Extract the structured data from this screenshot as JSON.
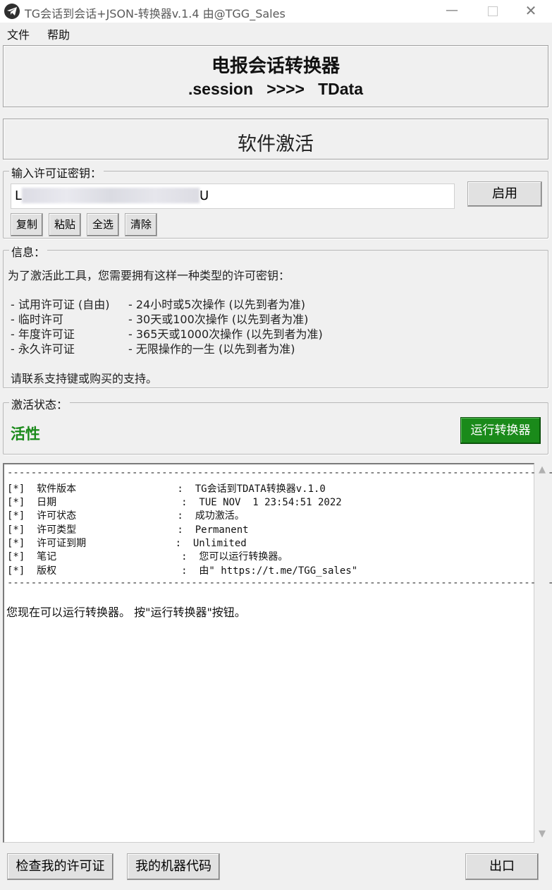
{
  "window": {
    "title": "TG会话到会话+JSON-转换器v.1.4 由@TGG_Sales",
    "controls": {
      "minimize": "—",
      "close": "✕"
    }
  },
  "menu": {
    "file": "文件",
    "help": "帮助"
  },
  "header": {
    "heading": "电报会话转换器",
    "subheading": ".session   >>>>   TData"
  },
  "activation": {
    "title": "软件激活"
  },
  "license": {
    "legend": "输入许可证密钥：",
    "key_start": "L",
    "key_end": "U",
    "enable_label": "启用",
    "copy_label": "复制",
    "paste_label": "粘贴",
    "select_all_label": "全选",
    "clear_label": "清除"
  },
  "info": {
    "legend": "信息：",
    "intro": "为了激活此工具，您需要拥有这样一种类型的许可密钥：",
    "license_types": [
      {
        "name": "- 试用许可证 (自由)",
        "desc": "- 24小时或5次操作 (以先到者为准)"
      },
      {
        "name": "- 临时许可",
        "desc": "- 30天或100次操作 (以先到者为准)"
      },
      {
        "name": "- 年度许可证",
        "desc": "- 365天或1000次操作 (以先到者为准)"
      },
      {
        "name": "- 永久许可证",
        "desc": "- 无限操作的一生 (以先到者为准)"
      }
    ],
    "contact": "请联系支持键或购买的支持。"
  },
  "status": {
    "legend": "激活状态：",
    "value": "活性",
    "run_label": "运行转换器",
    "colors": {
      "active_text": "#1b8a1b",
      "run_button": "#1a8a1a"
    }
  },
  "log": {
    "separator": "----------------------------------------------------------------------------------------------",
    "lines": [
      "[*]  软件版本                 :  TG会话到TDATA转换器v.1.0",
      "[*]  日期                     :  TUE NOV  1 23:54:51 2022",
      "[*]  许可状态                 :  成功激活。",
      "[*]  许可类型                 :  Permanent",
      "[*]  许可证到期               :  Unlimited",
      "[*]  笔记                     :  您可以运行转换器。",
      "[*]  版权                     :  由\" https://t.me/TGG_sales\""
    ],
    "message": "您现在可以运行转换器。 按\"运行转换器\"按钮。"
  },
  "bottom": {
    "check_license_label": "检查我的许可证",
    "machine_code_label": "我的机器代码",
    "exit_label": "出口"
  }
}
